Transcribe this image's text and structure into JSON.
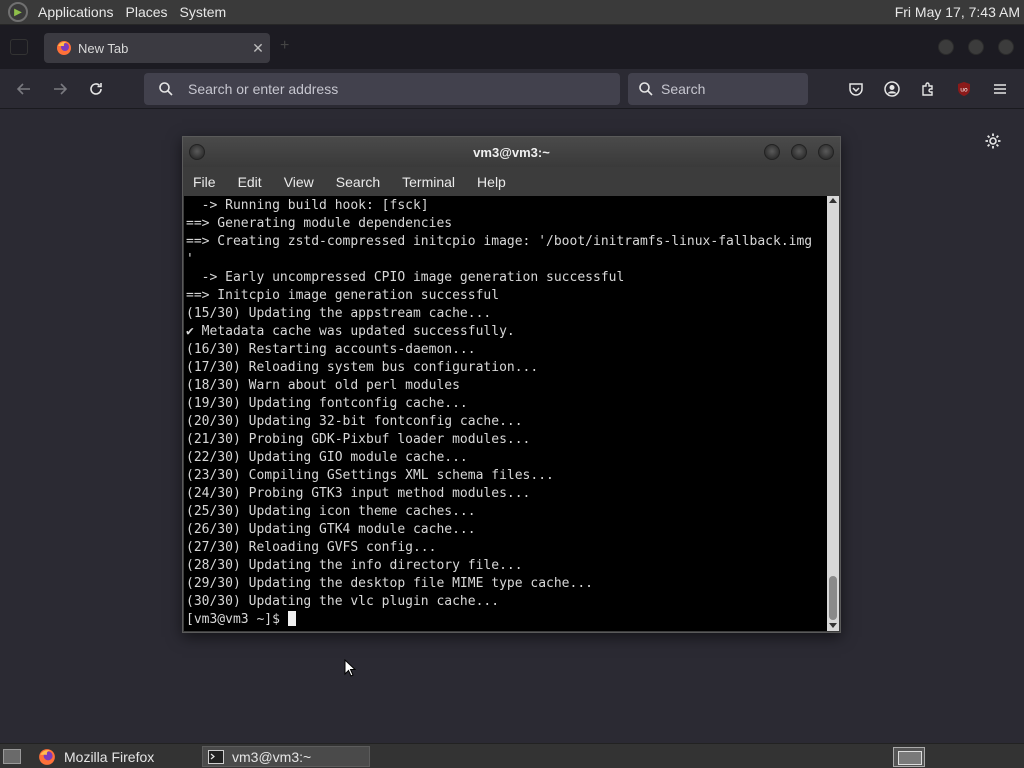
{
  "top_panel": {
    "menus": [
      "Applications",
      "Places",
      "System"
    ],
    "clock": "Fri May 17,  7:43 AM"
  },
  "browser": {
    "tab_title": "New Tab",
    "url_placeholder": "Search or enter address",
    "search_placeholder": "Search"
  },
  "terminal": {
    "title": "vm3@vm3:~",
    "menus": [
      "File",
      "Edit",
      "View",
      "Search",
      "Terminal",
      "Help"
    ],
    "lines": [
      "  -> Running build hook: [fsck]",
      "==> Generating module dependencies",
      "==> Creating zstd-compressed initcpio image: '/boot/initramfs-linux-fallback.img",
      "'",
      "  -> Early uncompressed CPIO image generation successful",
      "==> Initcpio image generation successful",
      "(15/30) Updating the appstream cache...",
      "✔ Metadata cache was updated successfully.",
      "(16/30) Restarting accounts-daemon...",
      "(17/30) Reloading system bus configuration...",
      "(18/30) Warn about old perl modules",
      "(19/30) Updating fontconfig cache...",
      "(20/30) Updating 32-bit fontconfig cache...",
      "(21/30) Probing GDK-Pixbuf loader modules...",
      "(22/30) Updating GIO module cache...",
      "(23/30) Compiling GSettings XML schema files...",
      "(24/30) Probing GTK3 input method modules...",
      "(25/30) Updating icon theme caches...",
      "(26/30) Updating GTK4 module cache...",
      "(27/30) Reloading GVFS config...",
      "(28/30) Updating the info directory file...",
      "(29/30) Updating the desktop file MIME type cache...",
      "(30/30) Updating the vlc plugin cache..."
    ],
    "prompt": "[vm3@vm3 ~]$ "
  },
  "taskbar": {
    "items": [
      "Mozilla Firefox",
      "vm3@vm3:~"
    ]
  },
  "colors": {
    "panel": "#3a3a3a",
    "firefox_bg": "#2b2a33",
    "terminal_bg": "#000000",
    "terminal_fg": "#d8d8d8",
    "ublock_red": "#8b1a1a"
  }
}
